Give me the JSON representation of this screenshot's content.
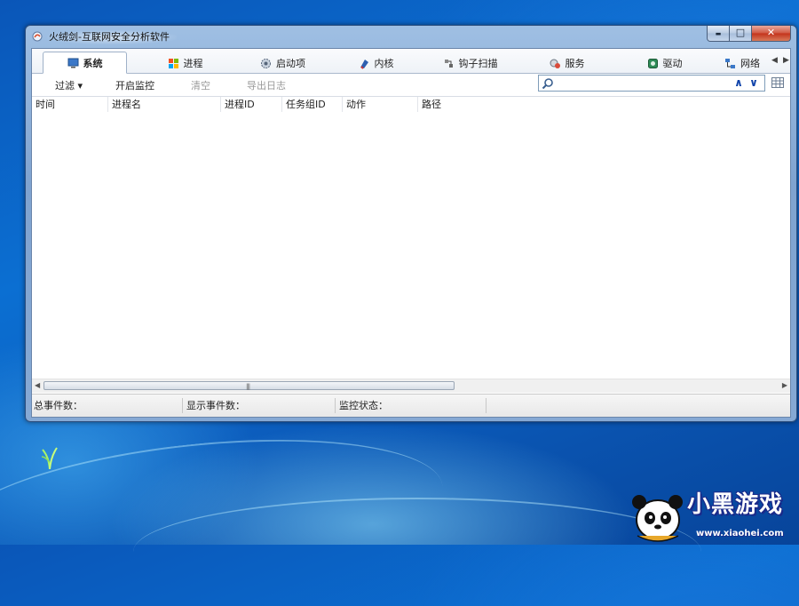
{
  "window": {
    "title": "火绒剑-互联网安全分析软件",
    "controls": {
      "minimize": "▬",
      "maximize": "□",
      "close": "✕"
    }
  },
  "tabs": [
    {
      "label": "系统",
      "icon": "monitor-icon",
      "active": true
    },
    {
      "label": "进程",
      "icon": "windows-flag-icon",
      "active": false
    },
    {
      "label": "启动项",
      "icon": "gear-icon",
      "active": false
    },
    {
      "label": "内核",
      "icon": "kernel-icon",
      "active": false
    },
    {
      "label": "钩子扫描",
      "icon": "hook-icon",
      "active": false
    },
    {
      "label": "服务",
      "icon": "service-icon",
      "active": false
    },
    {
      "label": "驱动",
      "icon": "driver-icon",
      "active": false
    },
    {
      "label": "网络",
      "icon": "network-icon",
      "active": false
    }
  ],
  "toolbar": {
    "filter": "过滤 ▾",
    "start_monitor": "开启监控",
    "clear": "清空",
    "export_log": "导出日志"
  },
  "search": {
    "value": "",
    "placeholder": ""
  },
  "table": {
    "columns": [
      "时间",
      "进程名",
      "进程ID",
      "任务组ID",
      "动作",
      "路径"
    ],
    "rows": []
  },
  "statusbar": {
    "total_events": "总事件数：",
    "shown_events": "显示事件数：",
    "monitor_status": "监控状态："
  },
  "watermark": {
    "brand": "小黑游戏",
    "url": "www.xiaohei.com"
  },
  "colors": {
    "desktop": "#0b6fd2",
    "window_frame": "#9fbfe3",
    "close_button": "#c3321b",
    "search_arrows": "#0a3fa8"
  }
}
